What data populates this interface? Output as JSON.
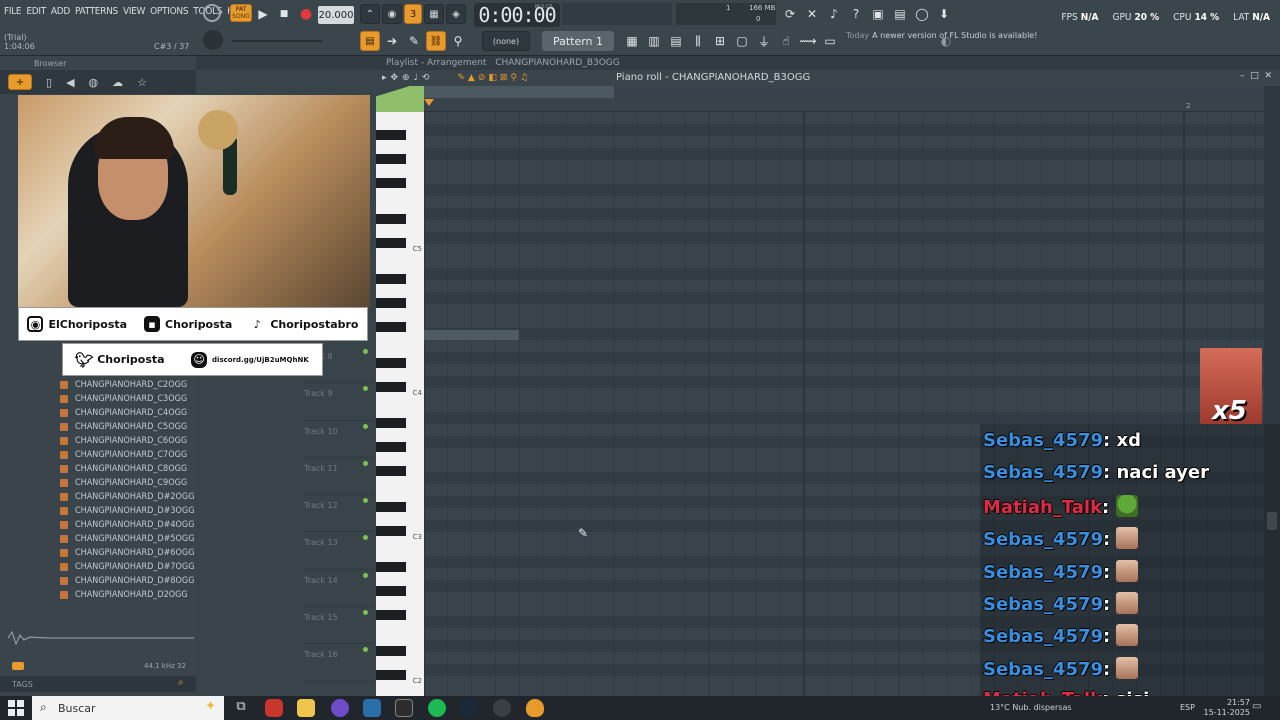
{
  "menu": [
    "FILE",
    "EDIT",
    "ADD",
    "PATTERNS",
    "VIEW",
    "OPTIONS",
    "TOOLS",
    "HELP"
  ],
  "trial_label": "(Trial)",
  "song_time_small": "1:04:06",
  "note_hint": "C#3 / 37",
  "tempo": "20.000",
  "song_time": "0:00:00",
  "time_unit": "M:S:CS",
  "memory": "166 MB",
  "cpu_meter_values": [
    "1",
    "0"
  ],
  "pat_song": [
    "PAT",
    "SONG"
  ],
  "snap_label": "(none)",
  "pattern_name": "Pattern 1",
  "news": {
    "date": "Today",
    "text": "A newer version of FL Studio is available!"
  },
  "stats": {
    "fps_label": "FPS",
    "fps": "N/A",
    "gpu_label": "GPU",
    "gpu": "20 %",
    "cpu_label": "CPU",
    "cpu": "14 %",
    "lat_label": "LAT",
    "lat": "N/A"
  },
  "browser_title": "Browser",
  "playlist_title": "Playlist - Arrangement",
  "playlist_pattern": "CHANGPIANOHARD_B3OGG",
  "piano_roll_title": "Piano roll - CHANGPIANOHARD_B3OGG",
  "timeline_marker": "2",
  "socials": {
    "instagram": "ElChoriposta",
    "kick": "Choriposta",
    "tiktok": "Choripostabro",
    "twitter": "Choriposta",
    "discord": "discord.gg/UjB2uMQhNK"
  },
  "files": [
    "CHANGPIANOHARD_C2OGG",
    "CHANGPIANOHARD_C3OGG",
    "CHANGPIANOHARD_C4OGG",
    "CHANGPIANOHARD_C5OGG",
    "CHANGPIANOHARD_C6OGG",
    "CHANGPIANOHARD_C7OGG",
    "CHANGPIANOHARD_C8OGG",
    "CHANGPIANOHARD_C9OGG",
    "CHANGPIANOHARD_D#2OGG",
    "CHANGPIANOHARD_D#3OGG",
    "CHANGPIANOHARD_D#4OGG",
    "CHANGPIANOHARD_D#5OGG",
    "CHANGPIANOHARD_D#6OGG",
    "CHANGPIANOHARD_D#7OGG",
    "CHANGPIANOHARD_D#8OGG",
    "CHANGPIANOHARD_D2OGG"
  ],
  "sample_info": "44.1 kHz 32",
  "tags_label": "TAGS",
  "tracks": [
    "Track 8",
    "Track 9",
    "Track 10",
    "Track 11",
    "Track 12",
    "Track 13",
    "Track 14",
    "Track 15",
    "Track 16"
  ],
  "octave_labels": [
    "C5",
    "C4",
    "C3",
    "C2"
  ],
  "chat": [
    {
      "user": "Sebas_4579",
      "text": "xd",
      "color": "#3a8fe0"
    },
    {
      "user": "Sebas_4579",
      "text": "naci ayer",
      "color": "#3a8fe0"
    },
    {
      "user": "Matiah_Talk",
      "text": "",
      "emote": "pepe",
      "color": "#e02b45"
    },
    {
      "user": "Sebas_4579",
      "text": "",
      "emote": "face",
      "color": "#3a8fe0"
    },
    {
      "user": "Sebas_4579",
      "text": "",
      "emote": "face",
      "color": "#3a8fe0"
    },
    {
      "user": "Sebas_4579",
      "text": "",
      "emote": "face",
      "color": "#3a8fe0"
    },
    {
      "user": "Sebas_4579",
      "text": "",
      "emote": "face",
      "color": "#3a8fe0"
    },
    {
      "user": "Sebas_4579",
      "text": "",
      "emote": "face",
      "color": "#3a8fe0"
    },
    {
      "user": "Matiah_Talk",
      "text": "sisi",
      "color": "#e02b45"
    }
  ],
  "sub_badge": "x5",
  "taskbar": {
    "search_placeholder": "Buscar",
    "weather": "Nub. dispersas",
    "temp": "13°C",
    "lang": "ESP",
    "time": "21:57",
    "date": "15-11-2025"
  },
  "colors": {
    "accent_orange": "#e89a2c",
    "chat_blue": "#3a8fe0",
    "chat_red": "#e02b45",
    "led_green": "#7fc04a"
  }
}
